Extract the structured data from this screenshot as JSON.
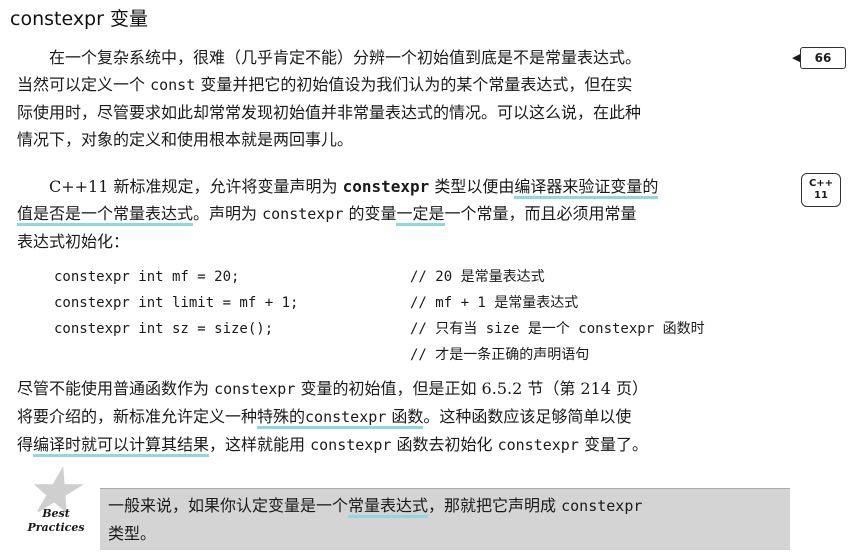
{
  "heading": "constexpr 变量",
  "para1": {
    "line1": "在一个复杂系统中，很难（几乎肯定不能）分辨一个初始值到底是不是常量表达式。",
    "line2a": "当然可以定义一个 ",
    "line2_code": "const",
    "line2b": " 变量并把它的初始值设为我们认为的某个常量表达式，但在实",
    "line3": "际使用时，尽管要求如此却常常发现初始值并非常量表达式的情况。可以这么说，在此种",
    "line4": "情况下，对象的定义和使用根本就是两回事儿。"
  },
  "margin_badge": "66",
  "cpp_badge": {
    "top": "C++",
    "bottom": "11"
  },
  "para2": {
    "a": "C++11 新标准规定，允许将变量声明为 ",
    "code": "constexpr",
    "b": " 类型以便由",
    "c_hl": "编译器来验证变量的",
    "d_hl": "值是否是一个常量表达式",
    "e": "。声明为 ",
    "code2": "constexpr",
    "f": " 的变量",
    "g_hl": "一定是",
    "h": "一个常量，而且必须用常量",
    "i": "表达式初始化："
  },
  "code": [
    {
      "stmt": "constexpr int mf = 20;",
      "comment": "// 20 是常量表达式"
    },
    {
      "stmt": "constexpr int limit = mf + 1;",
      "comment": "// mf + 1 是常量表达式"
    },
    {
      "stmt": "constexpr int sz = size();",
      "comment": "// 只有当 size 是一个 constexpr 函数时"
    },
    {
      "stmt": "",
      "comment": "// 才是一条正确的声明语句"
    }
  ],
  "para3": {
    "a": "尽管不能使用普通函数作为 ",
    "code": "constexpr",
    "b": " 变量的初始值，但是正如 6.5.2 节（第 214 页）",
    "c": "将要介绍的，新标准允许定义一种",
    "d_hl": "特殊的",
    "e_code_hl": "constexpr",
    "f_hl": " 函数",
    "g": "。这种函数应该足够简单以使",
    "h": "得",
    "i_hl": "编译时就可以计算其结果",
    "j": "，这样就能用 ",
    "code2": "constexpr",
    "k": " 函数去初始化 ",
    "code3": "constexpr",
    "l": " 变量了。"
  },
  "best_practices": {
    "label1": "Best",
    "label2": "Practices",
    "a": "一般来说，如果你认定变量是一个",
    "b_hl": "常量表达式",
    "c": "，那就把它声明成 ",
    "code": "constexpr",
    "d": "类型。"
  }
}
